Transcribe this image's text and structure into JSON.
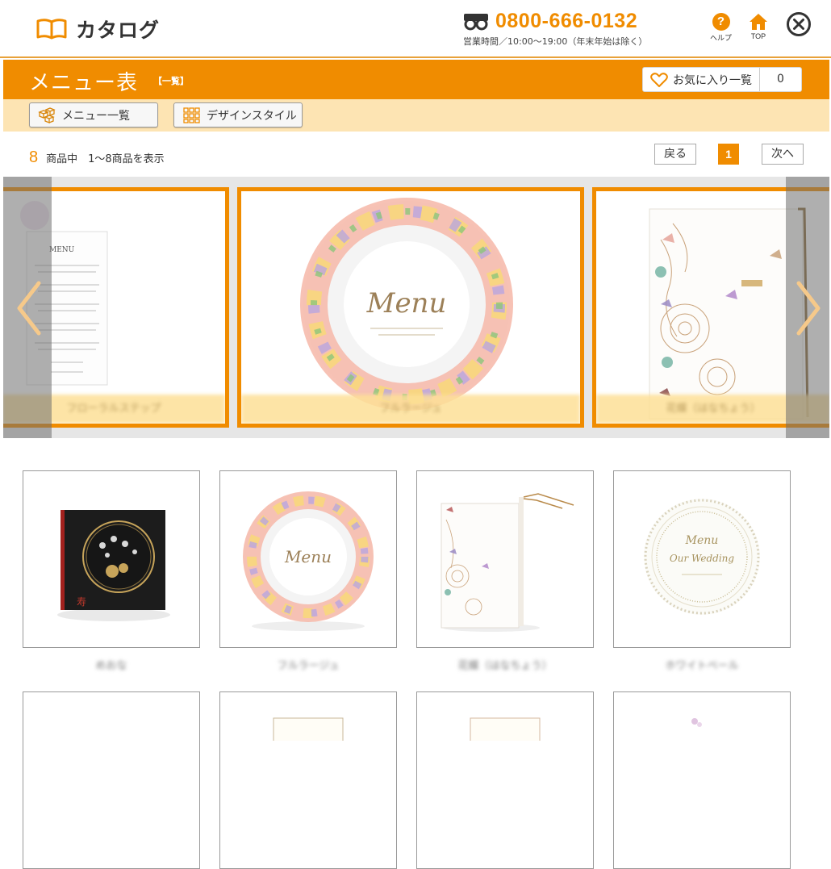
{
  "header": {
    "app_title": "カタログ",
    "phone_number": "0800-666-0132",
    "phone_hours": "営業時間／10:00〜19:00（年末年始は除く）",
    "help_label": "ヘルプ",
    "top_label": "TOP"
  },
  "titlebar": {
    "title": "メニュー表",
    "subtitle": "【一覧】",
    "favorites_label": "お気に入り一覧",
    "favorites_count": "0"
  },
  "subnav": {
    "menu_list_label": "メニュー一覧",
    "design_style_label": "デザインスタイル"
  },
  "results": {
    "count": "8",
    "text": "商品中　1〜8商品を表示"
  },
  "pager": {
    "prev_label": "戻る",
    "current_page": "1",
    "next_label": "次へ"
  },
  "carousel": {
    "slides": [
      {
        "caption": "フローラルステップ"
      },
      {
        "caption": "フルラージュ"
      },
      {
        "caption": "花蝶（はなちょう）"
      }
    ]
  },
  "products": [
    {
      "name": "めおな"
    },
    {
      "name": "フルラージュ"
    },
    {
      "name": "花蝶（はなちょう）"
    },
    {
      "name": "ホワイトベール"
    }
  ],
  "colors": {
    "accent": "#f08c00",
    "subnav_bg": "#fde4b3"
  }
}
